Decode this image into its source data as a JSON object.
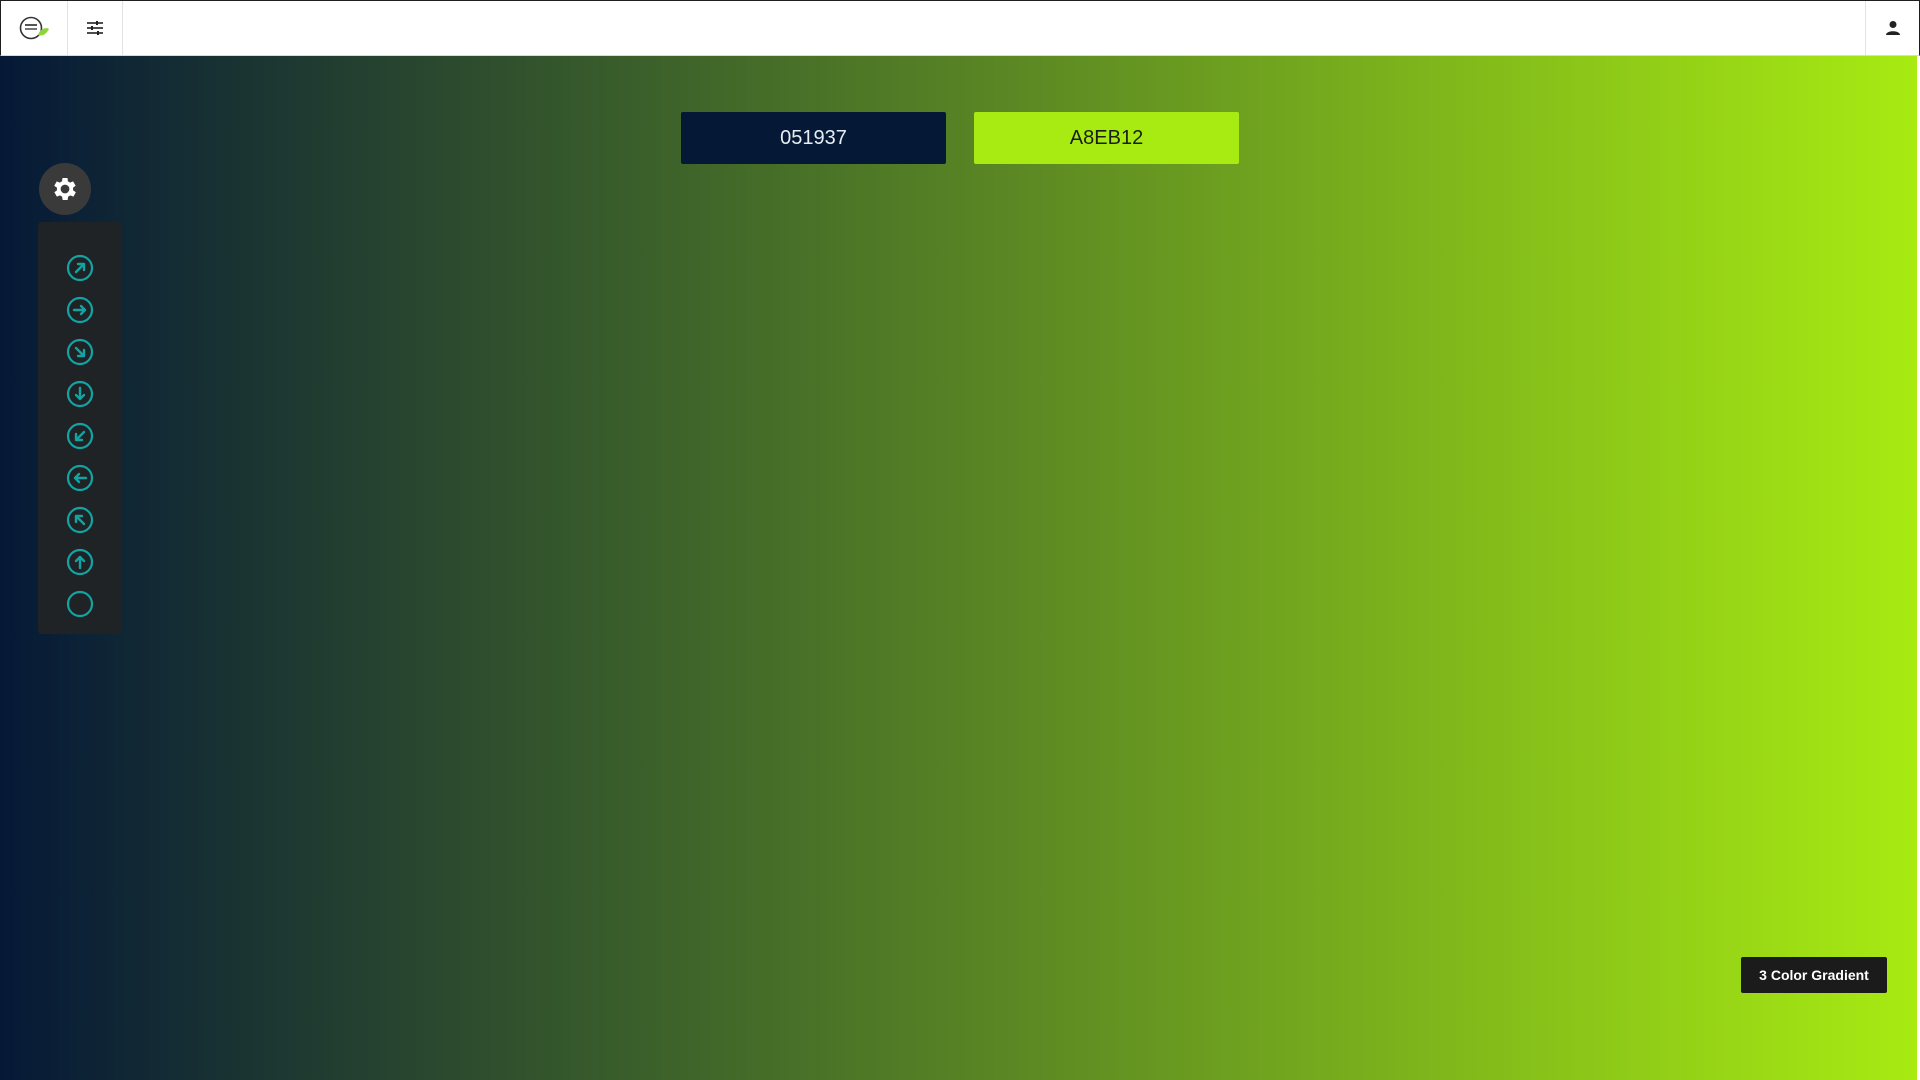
{
  "colors": {
    "start": "#051937",
    "end": "#A8EB12",
    "icon_accent": "#13A3A3"
  },
  "gradient": {
    "direction": "to right"
  },
  "swatches": [
    {
      "value": "051937",
      "bg": "#051937"
    },
    {
      "value": "A8EB12",
      "bg": "#A8EB12"
    }
  ],
  "toolbar": {
    "logo_icon": "logo-icon",
    "menu_icon": "sliders-icon",
    "user_icon": "user-icon"
  },
  "sidebar": {
    "settings_icon": "gear-icon",
    "directions": [
      {
        "name": "up-right",
        "icon": "arrow-up-right-circle-icon"
      },
      {
        "name": "right",
        "icon": "arrow-right-circle-icon"
      },
      {
        "name": "down-right",
        "icon": "arrow-down-right-circle-icon"
      },
      {
        "name": "down",
        "icon": "arrow-down-circle-icon"
      },
      {
        "name": "down-left",
        "icon": "arrow-down-left-circle-icon"
      },
      {
        "name": "left",
        "icon": "arrow-left-circle-icon"
      },
      {
        "name": "up-left",
        "icon": "arrow-up-left-circle-icon"
      },
      {
        "name": "up",
        "icon": "arrow-up-circle-icon"
      },
      {
        "name": "radial",
        "icon": "circle-icon"
      }
    ]
  },
  "gradient_type_button": {
    "label": "3 Color Gradient"
  }
}
